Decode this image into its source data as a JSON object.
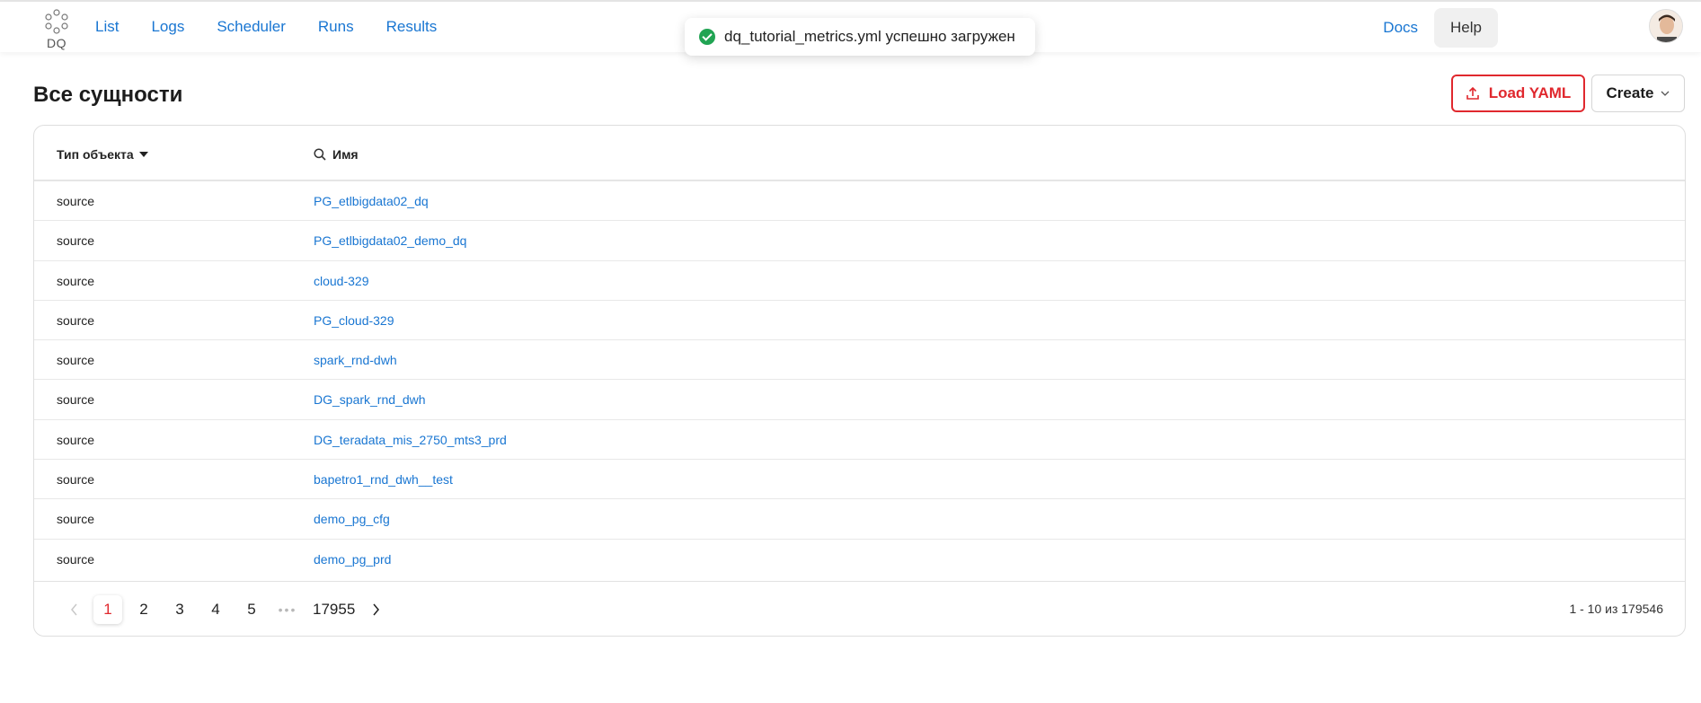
{
  "header": {
    "logo_text": "DQ",
    "nav": [
      "List",
      "Logs",
      "Scheduler",
      "Runs",
      "Results"
    ],
    "docs_label": "Docs",
    "help_label": "Help"
  },
  "toast": {
    "message": "dq_tutorial_metrics.yml успешно загружен",
    "status_color": "#21a453"
  },
  "page": {
    "title": "Все сущности",
    "load_yaml_label": "Load YAML",
    "create_label": "Create",
    "accent_color": "#e0282e"
  },
  "table": {
    "col_type": "Тип объекта",
    "col_name": "Имя",
    "rows": [
      {
        "type": "source",
        "name": "PG_etlbigdata02_dq"
      },
      {
        "type": "source",
        "name": "PG_etlbigdata02_demo_dq"
      },
      {
        "type": "source",
        "name": "cloud-329"
      },
      {
        "type": "source",
        "name": "PG_cloud-329"
      },
      {
        "type": "source",
        "name": "spark_rnd-dwh"
      },
      {
        "type": "source",
        "name": "DG_spark_rnd_dwh"
      },
      {
        "type": "source",
        "name": "DG_teradata_mis_2750_mts3_prd"
      },
      {
        "type": "source",
        "name": "bapetro1_rnd_dwh__test"
      },
      {
        "type": "source",
        "name": "demo_pg_cfg"
      },
      {
        "type": "source",
        "name": "demo_pg_prd"
      }
    ]
  },
  "pagination": {
    "pages": [
      "1",
      "2",
      "3",
      "4",
      "5"
    ],
    "ellipsis": "•••",
    "last_page": "17955",
    "current": "1",
    "range_text": "1 - 10 из 179546"
  }
}
